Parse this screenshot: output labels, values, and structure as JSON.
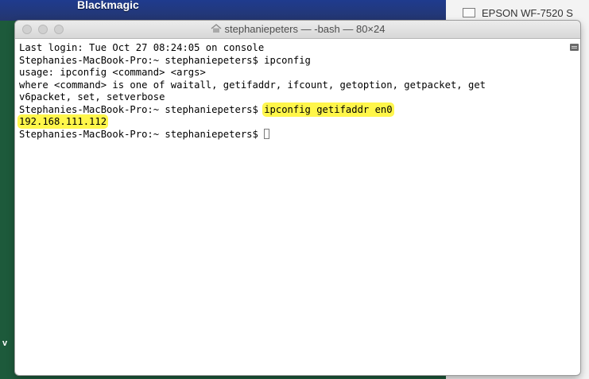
{
  "desktop": {
    "top_label": "Blackmagic",
    "side_glyph": "v",
    "printer_label": "EPSON WF-7520 S"
  },
  "window": {
    "title": "stephaniepeters — -bash — 80×24",
    "title_icon": "home-icon"
  },
  "terminal": {
    "lines": [
      "Last login: Tue Oct 27 08:24:05 on console",
      "Stephanies-MacBook-Pro:~ stephaniepeters$ ipconfig",
      "usage: ipconfig <command> <args>",
      "where <command> is one of waitall, getifaddr, ifcount, getoption, getpacket, get",
      "v6packet, set, setverbose"
    ],
    "prompt": "Stephanies-MacBook-Pro:~ stephaniepeters$ ",
    "highlighted_command": "ipconfig getifaddr en0",
    "ip_result": "192.168.111.112",
    "final_prompt": "Stephanies-MacBook-Pro:~ stephaniepeters$ ",
    "highlight_color": "#fff64a"
  },
  "colors": {
    "desktop_green": "#1d5a3b",
    "desktop_blue": "#1f3b8e"
  }
}
